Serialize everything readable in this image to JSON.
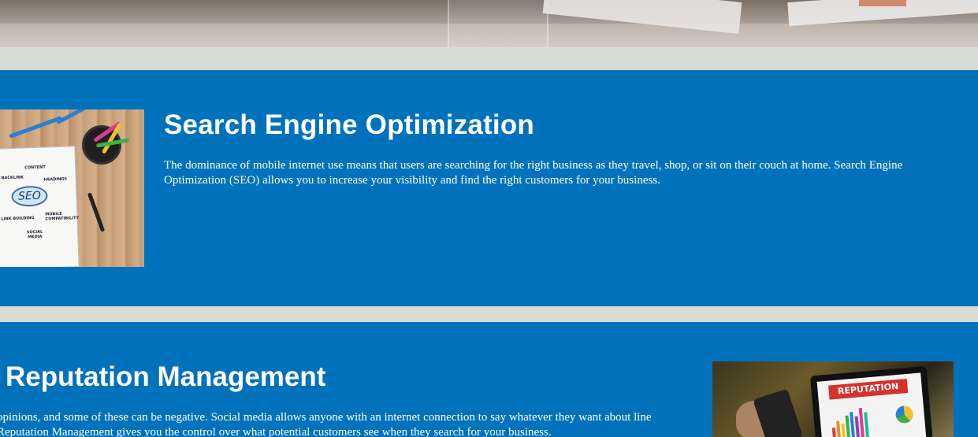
{
  "sections": {
    "seo": {
      "title": "Search Engine Optimization",
      "body": "The dominance of mobile internet use means that users are searching for the right business as they travel, shop, or sit on their couch at home. Search Engine Optimization (SEO) allows you to increase your visibility and find the right customers for your business.",
      "image_words": [
        "CONTENT",
        "BACKLINK",
        "HEADINGS",
        "SEO",
        "LINK BUILDING",
        "MOBILE COMPATIBILITY",
        "SOCIAL MEDIA"
      ]
    },
    "reputation": {
      "title": "Reputation Management",
      "body": "opinions, and some of these can be negative. Social media allows anyone with an internet connection to say whatever they want about line Reputation Management gives you the control over what potential customers see when they search for your business.",
      "image_words": [
        "REPUTATION"
      ]
    }
  },
  "colors": {
    "band": "#0072bc",
    "separator": "#d9dcd6",
    "text": "#ffffff"
  }
}
